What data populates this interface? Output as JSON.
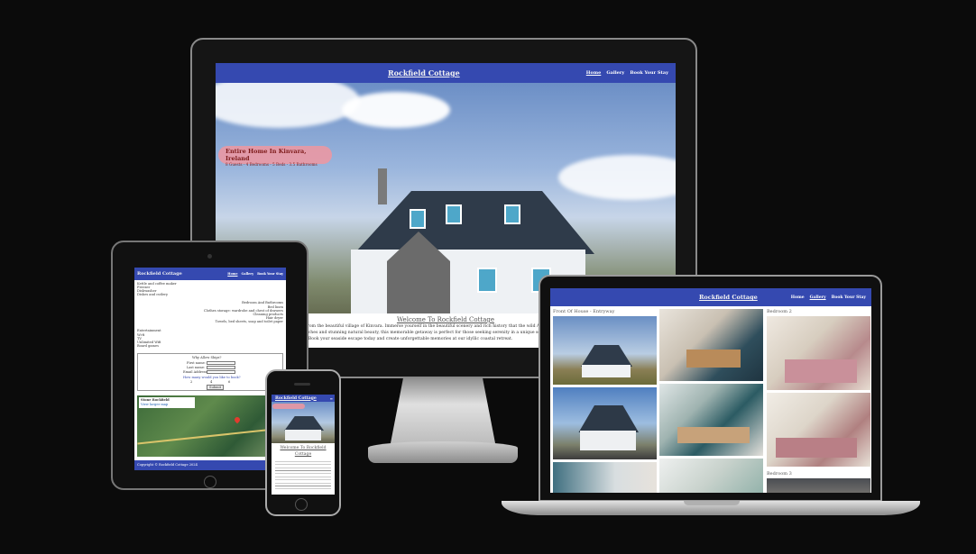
{
  "site": {
    "brand": "Rockfield Cottage",
    "nav": [
      "Home",
      "Gallery",
      "Book Your Stay"
    ]
  },
  "hero": {
    "badge_title": "Entire Home In Kinvara, Ireland",
    "badge_sub": "8 Guests - 4 Bedrooms - 5 Beds - 3.5 Bathrooms",
    "welcome_title": "Welcome To Rockfield Cottage",
    "welcome_lines": [
      "from the beautiful village of Kinvara. Immerse yourself in the beautiful scenery and rich history that the wild Al",
      "aches and stunning natural beauty, this memorable getaway is perfect for those seeking serenity in a unique sett",
      ". Book your seaside escape today and create unforgettable memories at our idyllic coastal retreat."
    ]
  },
  "gallery": {
    "captions": [
      "Front Of House - Entryway",
      "Bedroom 2",
      "Bedroom 3"
    ]
  },
  "tablet": {
    "amenities": [
      "Kettle and coffee maker",
      "Freezer",
      "Dishwasher",
      "Dishes and cutlery"
    ],
    "bedroom_title": "Bedroom And Bathrooms",
    "bedroom_lines": [
      "Bed linen",
      "Clothes storage: wardrobe and chest of drawers",
      "Cleaning products",
      "Hair dryer",
      "Towels, bed sheets, soap and toilet paper"
    ],
    "other_title": "Entertainment",
    "other_items": [
      "Wi-fi",
      "TV",
      "Unlimited Wifi",
      "Board games"
    ],
    "form_title": "Why Allow Ships?",
    "form_labels": [
      "First name:",
      "Last name:",
      "Email Address:"
    ],
    "form_question": "How many would you like to book?",
    "form_options": [
      "2",
      "4",
      "6"
    ],
    "submit": "Submit",
    "map_label": "Stone Rockfield",
    "map_link": "View larger map",
    "footer": "Copyright © Rockfield Cottage 2024"
  }
}
